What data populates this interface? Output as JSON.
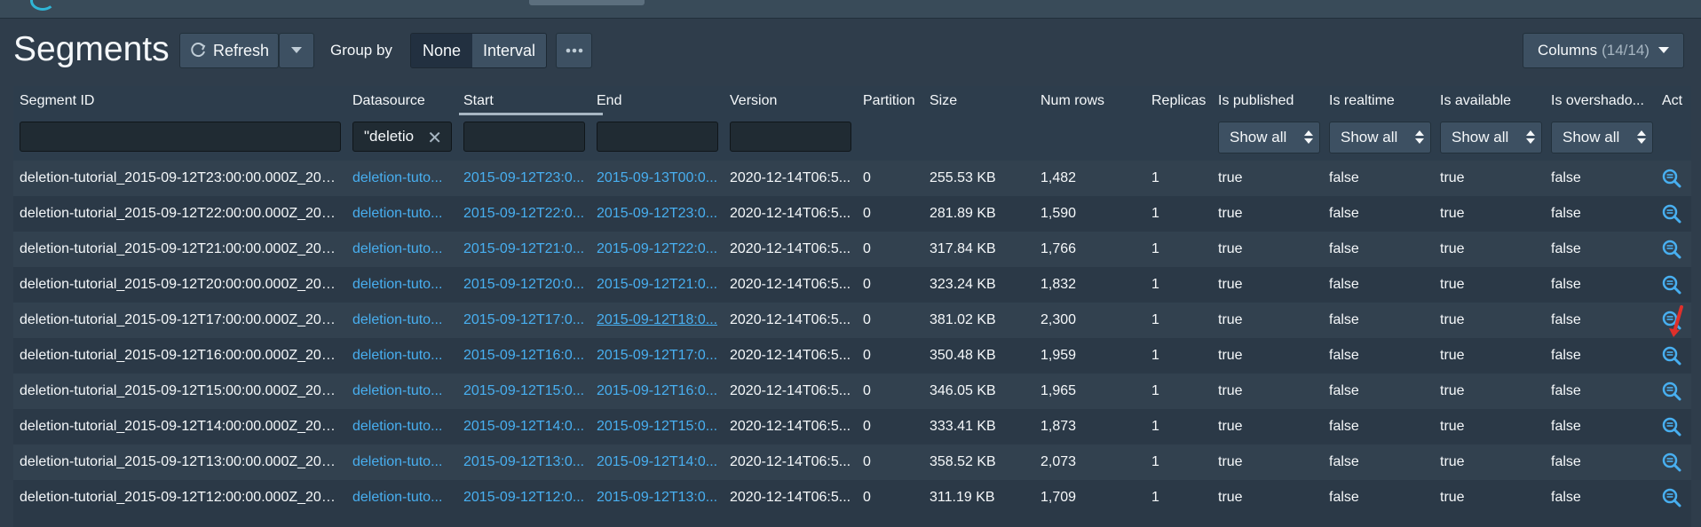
{
  "page": {
    "title": "Segments"
  },
  "toolbar": {
    "refresh_label": "Refresh",
    "group_by_label": "Group by",
    "group_by_options": [
      "None",
      "Interval"
    ],
    "group_by_selected": "None",
    "columns_label": "Columns",
    "columns_count": "(14/14)"
  },
  "table": {
    "headers": [
      "Segment ID",
      "Datasource",
      "Start",
      "End",
      "Version",
      "Partition",
      "Size",
      "Num rows",
      "Replicas",
      "Is published",
      "Is realtime",
      "Is available",
      "Is overshado...",
      "Act"
    ],
    "filters": {
      "datasource_value": "\"deletio",
      "show_all": "Show all"
    },
    "rows": [
      {
        "segment_id": "deletion-tutorial_2015-09-12T23:00:00.000Z_201...",
        "datasource": "deletion-tuto...",
        "start": "2015-09-12T23:0...",
        "end": "2015-09-13T00:0...",
        "version": "2020-12-14T06:5...",
        "partition": "0",
        "size": "255.53 KB",
        "num_rows": "1,482",
        "replicas": "1",
        "is_published": "true",
        "is_realtime": "false",
        "is_available": "true",
        "is_overshadowed": "false"
      },
      {
        "segment_id": "deletion-tutorial_2015-09-12T22:00:00.000Z_201...",
        "datasource": "deletion-tuto...",
        "start": "2015-09-12T22:0...",
        "end": "2015-09-12T23:0...",
        "version": "2020-12-14T06:5...",
        "partition": "0",
        "size": "281.89 KB",
        "num_rows": "1,590",
        "replicas": "1",
        "is_published": "true",
        "is_realtime": "false",
        "is_available": "true",
        "is_overshadowed": "false"
      },
      {
        "segment_id": "deletion-tutorial_2015-09-12T21:00:00.000Z_201...",
        "datasource": "deletion-tuto...",
        "start": "2015-09-12T21:0...",
        "end": "2015-09-12T22:0...",
        "version": "2020-12-14T06:5...",
        "partition": "0",
        "size": "317.84 KB",
        "num_rows": "1,766",
        "replicas": "1",
        "is_published": "true",
        "is_realtime": "false",
        "is_available": "true",
        "is_overshadowed": "false"
      },
      {
        "segment_id": "deletion-tutorial_2015-09-12T20:00:00.000Z_201...",
        "datasource": "deletion-tuto...",
        "start": "2015-09-12T20:0...",
        "end": "2015-09-12T21:0...",
        "version": "2020-12-14T06:5...",
        "partition": "0",
        "size": "323.24 KB",
        "num_rows": "1,832",
        "replicas": "1",
        "is_published": "true",
        "is_realtime": "false",
        "is_available": "true",
        "is_overshadowed": "false"
      },
      {
        "segment_id": "deletion-tutorial_2015-09-12T17:00:00.000Z_201...",
        "datasource": "deletion-tuto...",
        "start": "2015-09-12T17:0...",
        "end": "2015-09-12T18:0...",
        "version": "2020-12-14T06:5...",
        "partition": "0",
        "size": "381.02 KB",
        "num_rows": "2,300",
        "replicas": "1",
        "is_published": "true",
        "is_realtime": "false",
        "is_available": "true",
        "is_overshadowed": "false"
      },
      {
        "segment_id": "deletion-tutorial_2015-09-12T16:00:00.000Z_201...",
        "datasource": "deletion-tuto...",
        "start": "2015-09-12T16:0...",
        "end": "2015-09-12T17:0...",
        "version": "2020-12-14T06:5...",
        "partition": "0",
        "size": "350.48 KB",
        "num_rows": "1,959",
        "replicas": "1",
        "is_published": "true",
        "is_realtime": "false",
        "is_available": "true",
        "is_overshadowed": "false"
      },
      {
        "segment_id": "deletion-tutorial_2015-09-12T15:00:00.000Z_201...",
        "datasource": "deletion-tuto...",
        "start": "2015-09-12T15:0...",
        "end": "2015-09-12T16:0...",
        "version": "2020-12-14T06:5...",
        "partition": "0",
        "size": "346.05 KB",
        "num_rows": "1,965",
        "replicas": "1",
        "is_published": "true",
        "is_realtime": "false",
        "is_available": "true",
        "is_overshadowed": "false"
      },
      {
        "segment_id": "deletion-tutorial_2015-09-12T14:00:00.000Z_201...",
        "datasource": "deletion-tuto...",
        "start": "2015-09-12T14:0...",
        "end": "2015-09-12T15:0...",
        "version": "2020-12-14T06:5...",
        "partition": "0",
        "size": "333.41 KB",
        "num_rows": "1,873",
        "replicas": "1",
        "is_published": "true",
        "is_realtime": "false",
        "is_available": "true",
        "is_overshadowed": "false"
      },
      {
        "segment_id": "deletion-tutorial_2015-09-12T13:00:00.000Z_201...",
        "datasource": "deletion-tuto...",
        "start": "2015-09-12T13:0...",
        "end": "2015-09-12T14:0...",
        "version": "2020-12-14T06:5...",
        "partition": "0",
        "size": "358.52 KB",
        "num_rows": "2,073",
        "replicas": "1",
        "is_published": "true",
        "is_realtime": "false",
        "is_available": "true",
        "is_overshadowed": "false"
      },
      {
        "segment_id": "deletion-tutorial_2015-09-12T12:00:00.000Z_201...",
        "datasource": "deletion-tuto...",
        "start": "2015-09-12T12:0...",
        "end": "2015-09-12T13:0...",
        "version": "2020-12-14T06:5...",
        "partition": "0",
        "size": "311.19 KB",
        "num_rows": "1,709",
        "replicas": "1",
        "is_published": "true",
        "is_realtime": "false",
        "is_available": "true",
        "is_overshadowed": "false"
      }
    ],
    "underlined_end_row": 4
  },
  "icons": {
    "row_action": "magnifier-list-icon",
    "refresh": "refresh-icon",
    "more": "more-dots-icon",
    "caret": "caret-down-icon",
    "clear": "clear-x-icon"
  },
  "colors": {
    "link": "#48aff0",
    "background": "#2f3d4b",
    "cursor": "#e0302b"
  }
}
